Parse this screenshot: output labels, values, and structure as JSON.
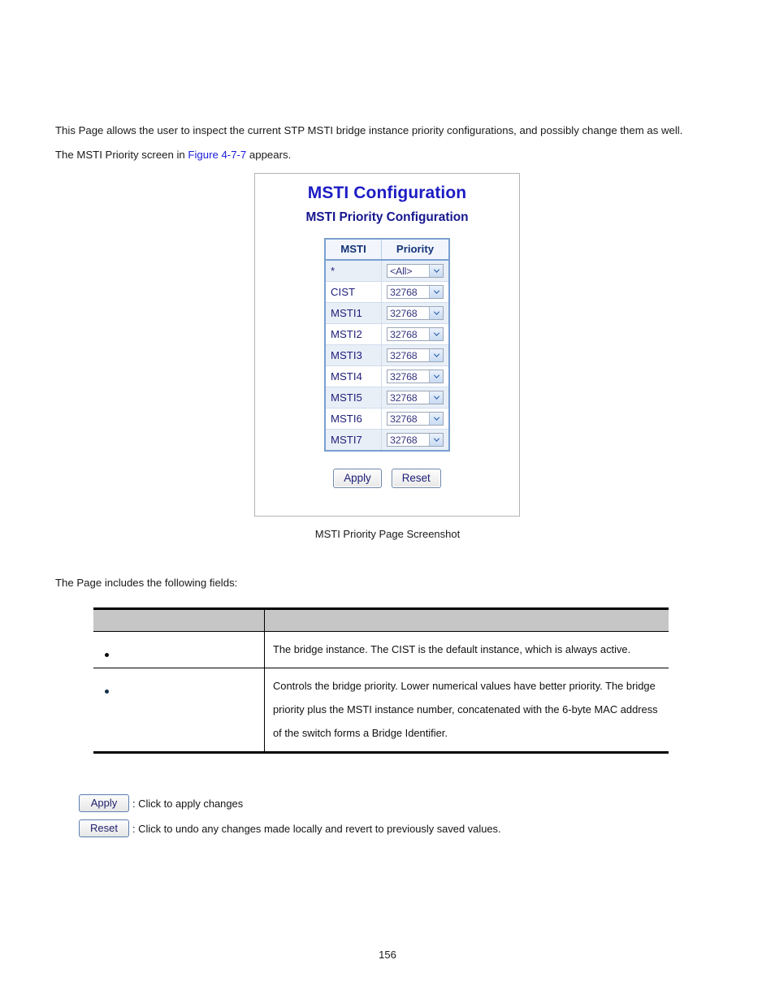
{
  "document": {
    "page_number": "156",
    "intro_line_1": "This Page allows the user to inspect the current STP MSTI bridge instance priority configurations, and possibly change them as well.",
    "intro_line_2_before_link": "The MSTI Priority screen in ",
    "intro_link": "Figure 4-7-7",
    "intro_line_2_after_link": " appears.",
    "figure_caption": "MSTI Priority Page Screenshot",
    "fields_intro": "The Page includes the following fields:"
  },
  "screenshot": {
    "title": "MSTI Configuration",
    "subtitle": "MSTI Priority Configuration",
    "table": {
      "headers": [
        "MSTI",
        "Priority"
      ],
      "rows": [
        {
          "msti": "*",
          "priority": "<All>"
        },
        {
          "msti": "CIST",
          "priority": "32768"
        },
        {
          "msti": "MSTI1",
          "priority": "32768"
        },
        {
          "msti": "MSTI2",
          "priority": "32768"
        },
        {
          "msti": "MSTI3",
          "priority": "32768"
        },
        {
          "msti": "MSTI4",
          "priority": "32768"
        },
        {
          "msti": "MSTI5",
          "priority": "32768"
        },
        {
          "msti": "MSTI6",
          "priority": "32768"
        },
        {
          "msti": "MSTI7",
          "priority": "32768"
        }
      ]
    },
    "buttons": {
      "apply": "Apply",
      "reset": "Reset"
    }
  },
  "fields_table": {
    "headers": [
      "",
      ""
    ],
    "rows": [
      {
        "name": "",
        "description": "The bridge instance. The CIST is the default instance, which is always active."
      },
      {
        "name": "",
        "description": "Controls the bridge priority. Lower numerical values have better priority. The bridge priority plus the MSTI instance number, concatenated with the 6-byte MAC address of the switch forms a Bridge Identifier."
      }
    ]
  },
  "button_legend": [
    {
      "button": "Apply",
      "text": ": Click to apply changes"
    },
    {
      "button": "Reset",
      "text": ": Click to undo any changes made locally and revert to previously saved values."
    }
  ],
  "colors": {
    "link": "#1b1bdd",
    "figure_title": "#1c1cc4",
    "figure_subtitle": "#16168f",
    "table_header_text": "#15347a",
    "table_border": "#7a9fd0"
  }
}
